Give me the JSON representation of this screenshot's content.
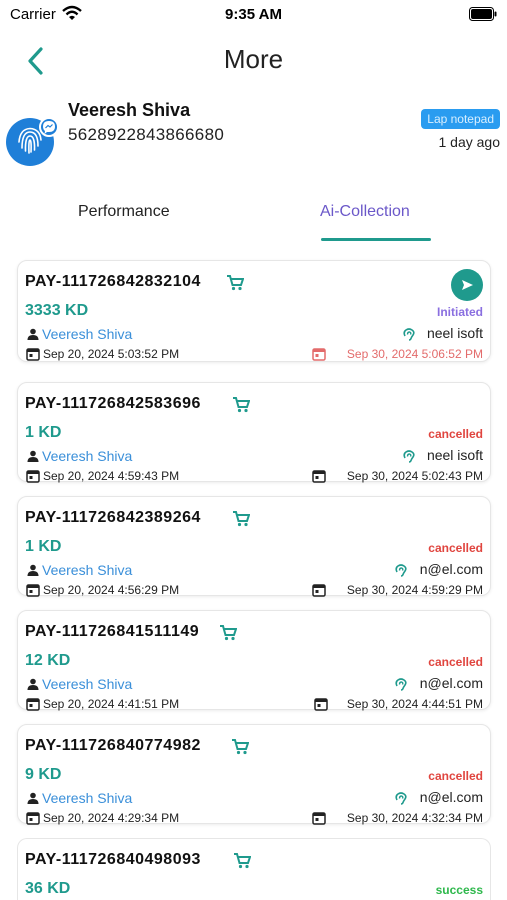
{
  "status_bar": {
    "carrier": "Carrier",
    "time": "9:35 AM"
  },
  "nav": {
    "title": "More"
  },
  "user": {
    "name": "Veeresh Shiva",
    "id": "5628922843866680",
    "tag": "Lap notepad",
    "time_ago": "1 day ago"
  },
  "tabs": [
    {
      "label": "Performance",
      "active": false
    },
    {
      "label": "Ai-Collection",
      "active": true
    }
  ],
  "colors": {
    "accent": "#1f9a8d",
    "tab_active": "#6b58c9",
    "link": "#3a8fd9",
    "cancelled": "#e0453f",
    "initiated": "#8a6fe0",
    "success": "#2eb84c"
  },
  "payments": [
    {
      "id": "PAY-111726842832104",
      "amount": "3333 KD",
      "status": "Initiated",
      "agent": "Veeresh Shiva",
      "contact": "neel isoft",
      "start": "Sep 20, 2024 5:03:52 PM",
      "end": "Sep 30, 2024 5:06:52 PM"
    },
    {
      "id": "PAY-111726842583696",
      "amount": "1 KD",
      "status": "cancelled",
      "agent": "Veeresh Shiva",
      "contact": "neel isoft",
      "start": "Sep 20, 2024 4:59:43 PM",
      "end": "Sep 30, 2024 5:02:43 PM"
    },
    {
      "id": "PAY-111726842389264",
      "amount": "1 KD",
      "status": "cancelled",
      "agent": "Veeresh Shiva",
      "contact": "n@el.com",
      "start": "Sep 20, 2024 4:56:29 PM",
      "end": "Sep 30, 2024 4:59:29 PM"
    },
    {
      "id": "PAY-111726841511149",
      "amount": "12 KD",
      "status": "cancelled",
      "agent": "Veeresh Shiva",
      "contact": "n@el.com",
      "start": "Sep 20, 2024 4:41:51 PM",
      "end": "Sep 30, 2024 4:44:51 PM"
    },
    {
      "id": "PAY-111726840774982",
      "amount": "9 KD",
      "status": "cancelled",
      "agent": "Veeresh Shiva",
      "contact": "n@el.com",
      "start": "Sep 20, 2024 4:29:34 PM",
      "end": "Sep 30, 2024 4:32:34 PM"
    },
    {
      "id": "PAY-111726840498093",
      "amount": "36 KD",
      "status": "success"
    }
  ]
}
